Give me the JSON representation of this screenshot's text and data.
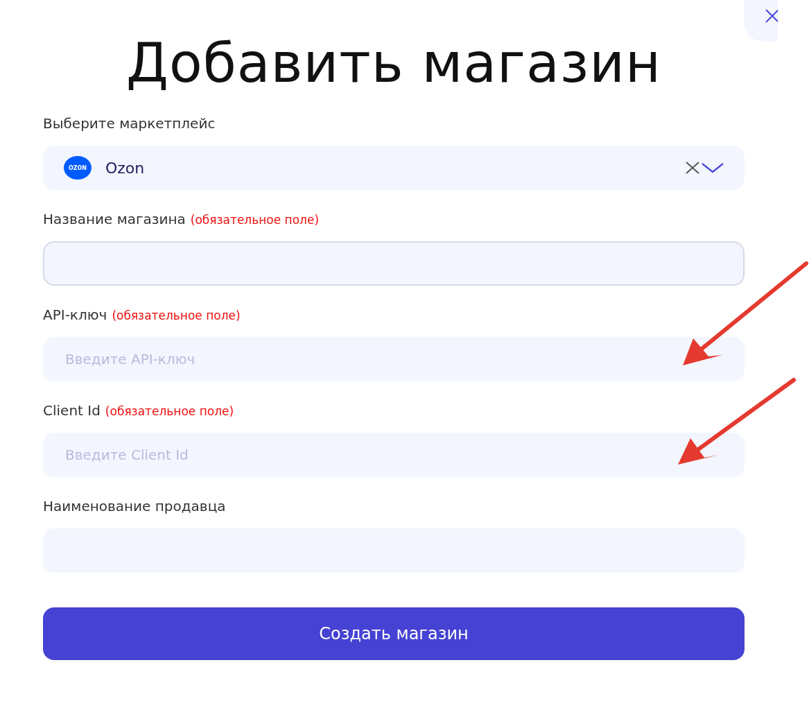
{
  "title": "Добавить магазин",
  "marketplace": {
    "label": "Выберите маркетплейс",
    "logo_text": "OZON",
    "value": "Ozon"
  },
  "fields": [
    {
      "label": "Название магазина",
      "required_note": "(обязательное поле)",
      "focused": true
    },
    {
      "label": "API-ключ",
      "required_note": "(обязательное поле)",
      "placeholder": "Введите API-ключ",
      "focused": false
    },
    {
      "label": "Client Id",
      "required_note": "(обязательное поле)",
      "placeholder": "Введите Client Id",
      "focused": false
    },
    {
      "label": "Наименование продавца",
      "focused": false
    }
  ],
  "submit_button": "Создать магазин"
}
